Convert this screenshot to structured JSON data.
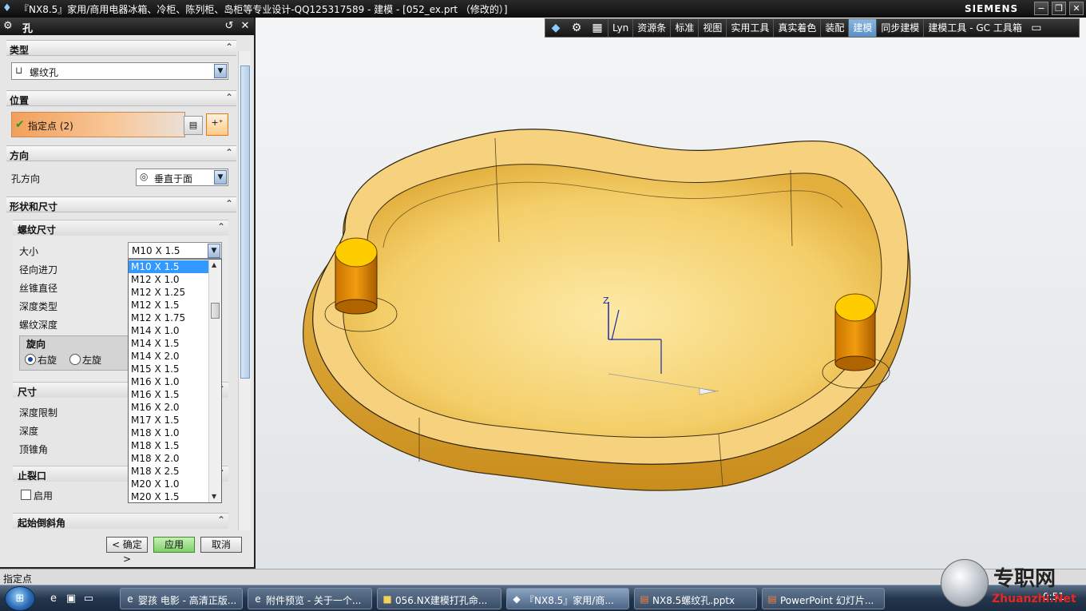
{
  "window": {
    "title": "『NX8.5』家用/商用电器冰箱、冷柜、陈列柜、岛柜等专业设计-QQ125317589 - 建模 - [052_ex.prt （修改的）]",
    "brand": "SIEMENS"
  },
  "toolbar": {
    "tabs": [
      "Lyn",
      "资源条",
      "标准",
      "视图",
      "实用工具",
      "真实着色",
      "装配",
      "建模",
      "同步建模",
      "建模工具 - GC 工具箱"
    ],
    "active_tab": "建模"
  },
  "dialog": {
    "title": "孔",
    "sections": {
      "type": {
        "label": "类型",
        "value": "螺纹孔"
      },
      "position": {
        "label": "位置",
        "pick_label": "指定点 (2)"
      },
      "direction": {
        "label": "方向",
        "field_label": "孔方向",
        "value": "垂直于面"
      },
      "shape": {
        "label": "形状和尺寸",
        "thread": {
          "label": "螺纹尺寸",
          "fields": [
            "大小",
            "径向进刀",
            "丝锥直径",
            "深度类型",
            "螺纹深度"
          ],
          "size_value": "M10 X 1.5",
          "rotation": {
            "label": "旋向",
            "right": "右旋",
            "left": "左旋",
            "selected": "右旋"
          }
        },
        "dimensions": {
          "label": "尺寸",
          "fields": [
            "深度限制",
            "深度",
            "顶锥角"
          ]
        },
        "relief": {
          "label": "止裂口",
          "enable_label": "启用"
        },
        "chamfer": {
          "label": "起始倒斜角"
        }
      }
    },
    "size_options": [
      "M10 X 1.5",
      "M12 X 1.0",
      "M12 X 1.25",
      "M12 X 1.5",
      "M12 X 1.75",
      "M14 X 1.0",
      "M14 X 1.5",
      "M14 X 2.0",
      "M15 X 1.5",
      "M16 X 1.0",
      "M16 X 1.5",
      "M16 X 2.0",
      "M17 X 1.5",
      "M18 X 1.0",
      "M18 X 1.5",
      "M18 X 2.0",
      "M18 X 2.5",
      "M20 X 1.0",
      "M20 X 1.5"
    ],
    "selected_size": "M10 X 1.5",
    "buttons": {
      "ok": "< 确定 >",
      "apply": "应用",
      "cancel": "取消"
    }
  },
  "status": {
    "message": "指定点"
  },
  "viewport": {
    "axis_z_label": "Z"
  },
  "taskbar": {
    "items": [
      "婴孩 电影 - 高清正版...",
      "附件预览 - 关于一个...",
      "056.NX建模打孔命...",
      "『NX8.5』家用/商...",
      "NX8.5螺纹孔.pptx",
      "PowerPoint 幻灯片..."
    ],
    "clock": "0:51"
  },
  "watermark": {
    "text": "专职网",
    "url": "Zhuanzhi.Net"
  }
}
